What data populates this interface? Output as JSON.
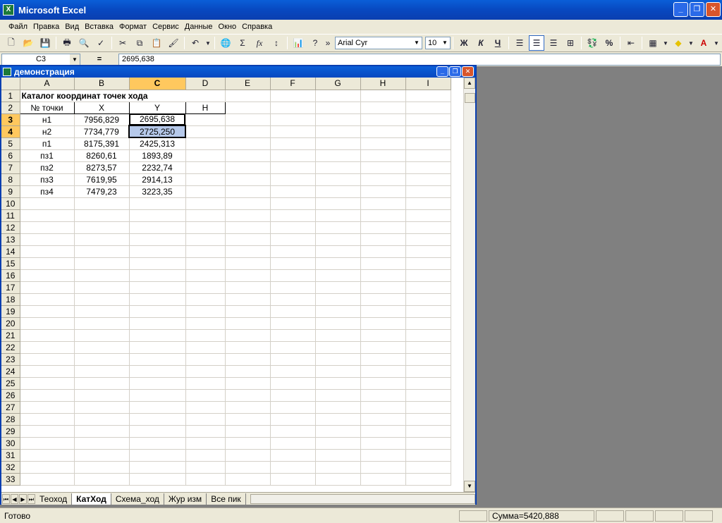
{
  "window": {
    "title": "Microsoft Excel",
    "app_icon": "X"
  },
  "menu": [
    "Файл",
    "Правка",
    "Вид",
    "Вставка",
    "Формат",
    "Сервис",
    "Данные",
    "Окно",
    "Справка"
  ],
  "toolbar": {
    "font": "Arial Cyr",
    "size": "10",
    "bold": "Ж",
    "italic": "К",
    "underline": "Ч",
    "sigma": "Σ",
    "fx": "fx",
    "percent": "%"
  },
  "formula_bar": {
    "cell_ref": "C3",
    "eq": "=",
    "value": "2695,638"
  },
  "workbook": {
    "title": "демонстрация"
  },
  "columns": [
    "A",
    "B",
    "C",
    "D",
    "E",
    "F",
    "G",
    "H",
    "I"
  ],
  "sheet": {
    "title": "Каталог координат точек хода",
    "headers": [
      "№ точки",
      "X",
      "Y",
      "H"
    ],
    "rows": [
      [
        "н1",
        "7956,829",
        "2695,638"
      ],
      [
        "н2",
        "7734,779",
        "2725,250"
      ],
      [
        "п1",
        "8175,391",
        "2425,313"
      ],
      [
        "пз1",
        "8260,61",
        "1893,89"
      ],
      [
        "пз2",
        "8273,57",
        "2232,74"
      ],
      [
        "пз3",
        "7619,95",
        "2914,13"
      ],
      [
        "пз4",
        "7479,23",
        "3223,35"
      ]
    ],
    "row_numbers": [
      "1",
      "2",
      "3",
      "4",
      "5",
      "6",
      "7",
      "8",
      "9",
      "10",
      "11",
      "12",
      "13",
      "14",
      "15",
      "16",
      "17",
      "18",
      "19",
      "20",
      "21",
      "22",
      "23",
      "24",
      "25",
      "26",
      "27",
      "28",
      "29",
      "30",
      "31",
      "32",
      "33"
    ]
  },
  "tabs": [
    "Теоход",
    "КатХод",
    "Схема_ход",
    "Жур изм",
    "Все пик"
  ],
  "status": {
    "ready": "Готово",
    "sum": "Сумма=5420,888"
  }
}
